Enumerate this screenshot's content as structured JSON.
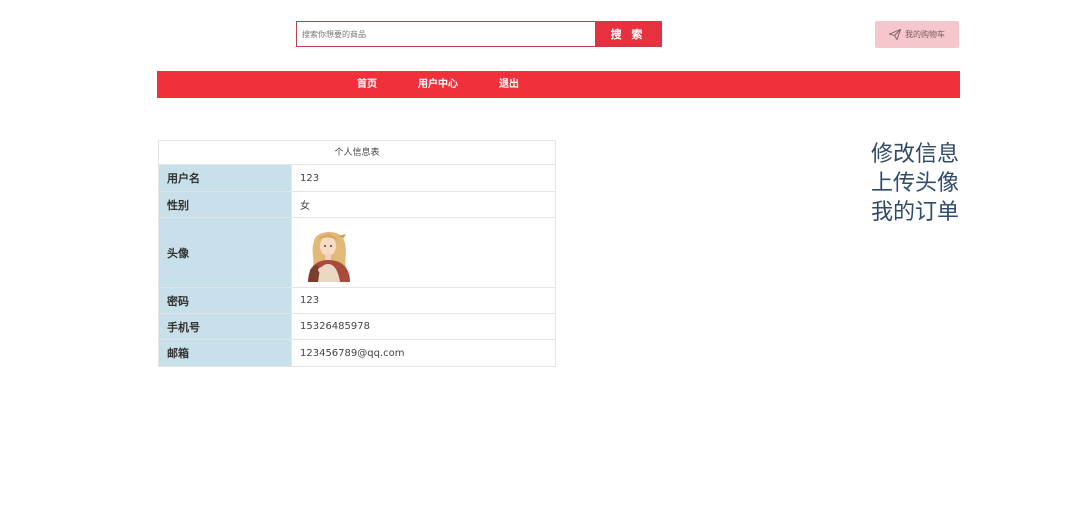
{
  "search": {
    "placeholder": "搜索你想要的商品",
    "button_label": "搜 索"
  },
  "cart": {
    "label": "我的购物车",
    "icon": "paper-plane-icon"
  },
  "nav": {
    "items": [
      {
        "label": "首页"
      },
      {
        "label": "用户中心"
      },
      {
        "label": "退出"
      }
    ]
  },
  "profile": {
    "caption": "个人信息表",
    "rows": [
      {
        "label": "用户名",
        "value": "123"
      },
      {
        "label": "性别",
        "value": "女"
      },
      {
        "label": "头像",
        "value": ""
      },
      {
        "label": "密码",
        "value": "123"
      },
      {
        "label": "手机号",
        "value": "15326485978"
      },
      {
        "label": "邮箱",
        "value": "123456789@qq.com"
      }
    ]
  },
  "side_links": [
    {
      "label": "修改信息"
    },
    {
      "label": "上传头像"
    },
    {
      "label": "我的订单"
    }
  ],
  "colors": {
    "accent": "#f0313c",
    "label_bg": "#c8e0e9",
    "link": "#2e4a6c",
    "cart_bg": "#f6c6cd"
  }
}
